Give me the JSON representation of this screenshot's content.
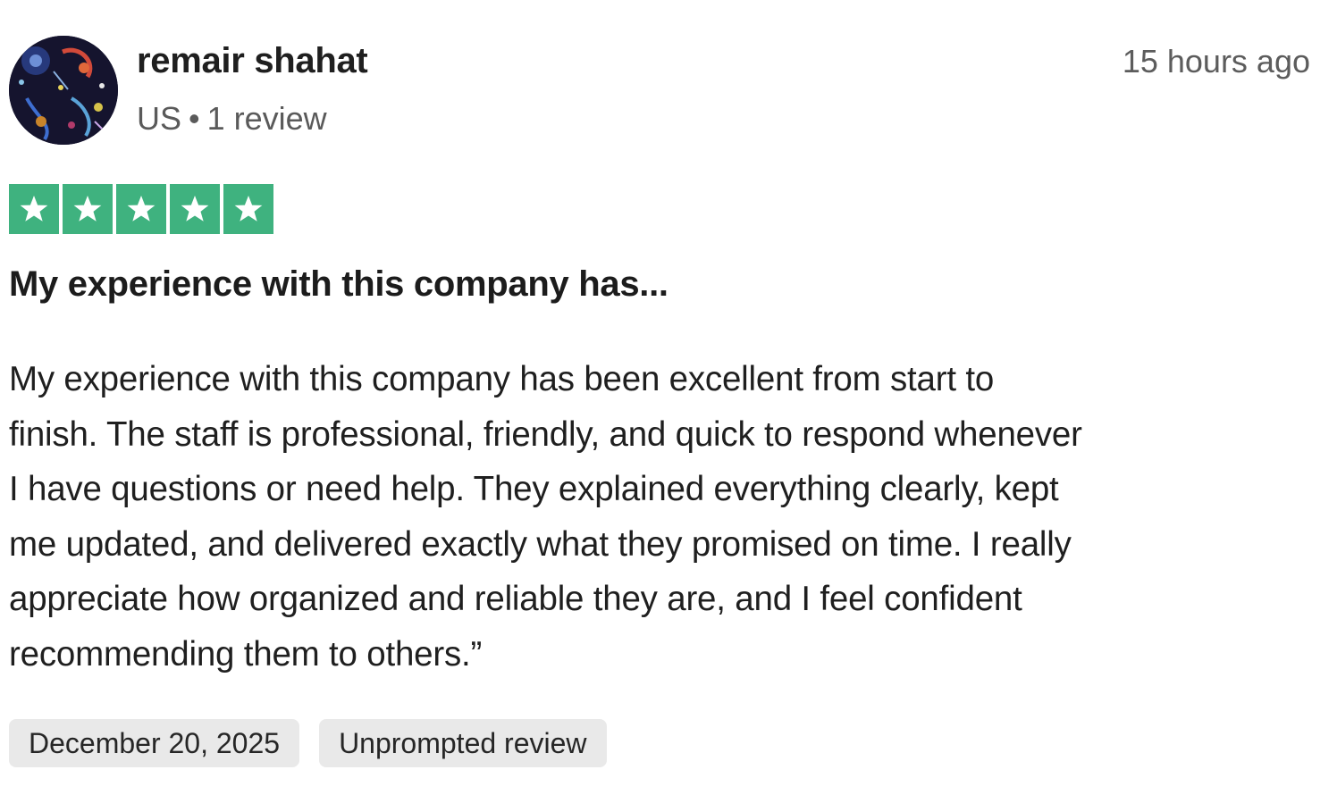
{
  "review": {
    "consumer": {
      "name": "remair shahat",
      "country": "US",
      "separator": "•",
      "review_count_label": "1 review"
    },
    "time_ago": "15 hours ago",
    "rating": {
      "value": 5,
      "max": 5,
      "star_color": "#3fb27f",
      "star_icon": "star-icon"
    },
    "title": "My experience with this company has...",
    "body_lines": [
      "My experience with this company has been excellent from start to",
      "finish. The staff is professional, friendly, and quick to respond whenever",
      "I have questions or need help. They explained everything clearly, kept",
      "me updated, and delivered exactly what they promised on time. I really",
      "appreciate how organized and reliable they are, and I feel confident",
      "recommending them to others.”"
    ],
    "tags": {
      "date": "December 20, 2025",
      "unprompted": "Unprompted review"
    }
  }
}
